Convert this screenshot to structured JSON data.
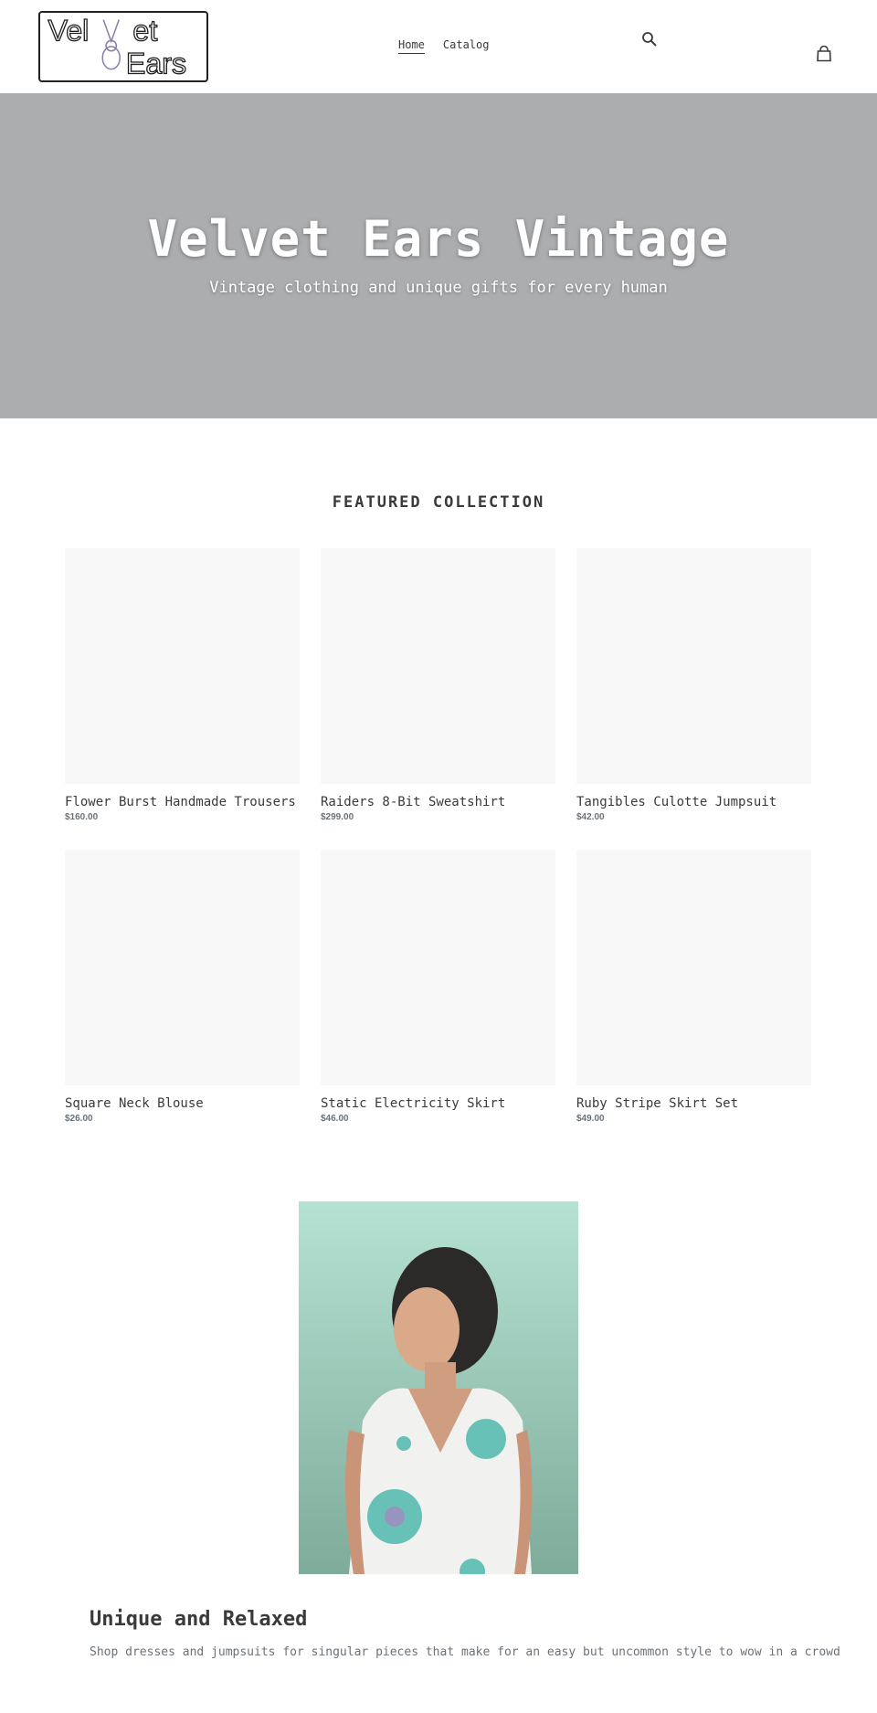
{
  "header": {
    "logo_text": "Velvet Ears",
    "nav": [
      {
        "label": "Home",
        "active": true
      },
      {
        "label": "Catalog",
        "active": false
      }
    ],
    "icons": [
      "search-icon",
      "cart-icon"
    ]
  },
  "hero": {
    "title": "Velvet Ears Vintage",
    "subtitle": "Vintage clothing and unique gifts for every human",
    "background_color": "#acadaf"
  },
  "featured": {
    "title": "FEATURED COLLECTION",
    "products": [
      {
        "title": "Flower Burst Handmade Trousers",
        "price": "$160.00"
      },
      {
        "title": "Raiders 8-Bit Sweatshirt",
        "price": "$299.00"
      },
      {
        "title": "Tangibles Culotte Jumpsuit",
        "price": "$42.00"
      },
      {
        "title": "Square Neck Blouse",
        "price": "$26.00"
      },
      {
        "title": "Static Electricity Skirt",
        "price": "$46.00"
      },
      {
        "title": "Ruby Stripe Skirt Set",
        "price": "$49.00"
      }
    ]
  },
  "feature": {
    "heading": "Unique and Relaxed",
    "text": "Shop dresses and jumpsuits for singular pieces that make for an easy but uncommon style to wow in a crowd"
  }
}
